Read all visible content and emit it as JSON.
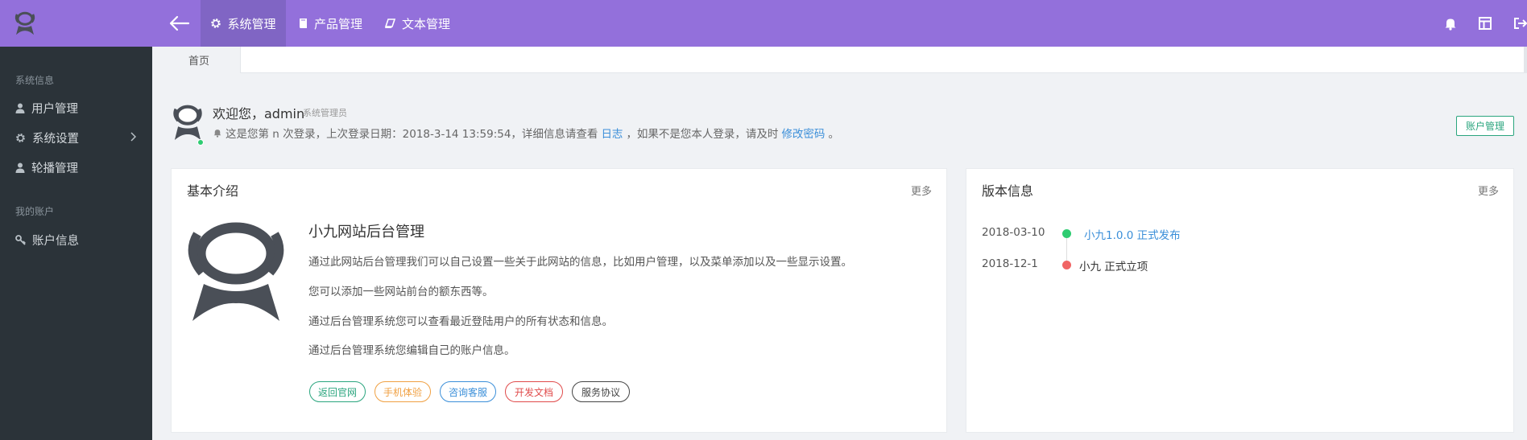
{
  "topbar": {
    "nav": [
      {
        "label": "系统管理",
        "icon": "gear-icon",
        "active": true
      },
      {
        "label": "产品管理",
        "icon": "book-icon",
        "active": false
      },
      {
        "label": "文本管理",
        "icon": "book-open-icon",
        "active": false
      }
    ],
    "right_icons": [
      "bell-icon",
      "layout-icon",
      "logout-icon"
    ]
  },
  "sidebar": {
    "sections": [
      {
        "title": "系统信息",
        "items": [
          {
            "label": "用户管理",
            "icon": "user-icon",
            "has_children": false
          },
          {
            "label": "系统设置",
            "icon": "gear-icon",
            "has_children": true
          },
          {
            "label": "轮播管理",
            "icon": "user-icon",
            "has_children": false
          }
        ]
      },
      {
        "title": "我的账户",
        "items": [
          {
            "label": "账户信息",
            "icon": "key-icon",
            "has_children": false
          }
        ]
      }
    ]
  },
  "tabs": [
    {
      "label": "首页"
    }
  ],
  "welcome": {
    "greeting": "欢迎您，admin",
    "role": "系统管理员",
    "line_before_log": "这是您第 n 次登录，上次登录日期：2018-3-14 13:59:54，详细信息请查看",
    "log_link": "日志",
    "line_middle": "，如果不是您本人登录，请及时",
    "password_link": "修改密码",
    "line_end": "。",
    "account_button": "账户管理"
  },
  "intro": {
    "title": "基本介绍",
    "more": "更多",
    "heading": "小九网站后台管理",
    "paragraphs": [
      "通过此网站后台管理我们可以自己设置一些关于此网站的信息，比如用户管理，以及菜单添加以及一些显示设置。",
      "您可以添加一些网站前台的额东西等。",
      "通过后台管理系统您可以查看最近登陆用户的所有状态和信息。",
      "通过后台管理系统您编辑自己的账户信息。"
    ],
    "tags": [
      {
        "label": "返回官网",
        "color": "#2aa57e"
      },
      {
        "label": "手机体验",
        "color": "#f0a042"
      },
      {
        "label": "咨询客服",
        "color": "#3b8fd9"
      },
      {
        "label": "开发文档",
        "color": "#e04b4b"
      },
      {
        "label": "服务协议",
        "color": "#444444"
      }
    ]
  },
  "version": {
    "title": "版本信息",
    "more": "更多",
    "timeline": [
      {
        "date": "2018-03-10",
        "text": "小九1.0.0 正式发布",
        "dot_color": "#2ecc71",
        "text_color": "#3b8fd9"
      },
      {
        "date": "2018-12-1",
        "text": "小九 正式立项",
        "dot_color": "#f06464",
        "text_color": "#333333"
      }
    ]
  },
  "colors": {
    "topbar": "#9370db",
    "topbar_active": "#8065c4",
    "sidebar": "#2b3339",
    "accent_green": "#2aa57e",
    "link_blue": "#3b8fd9"
  }
}
